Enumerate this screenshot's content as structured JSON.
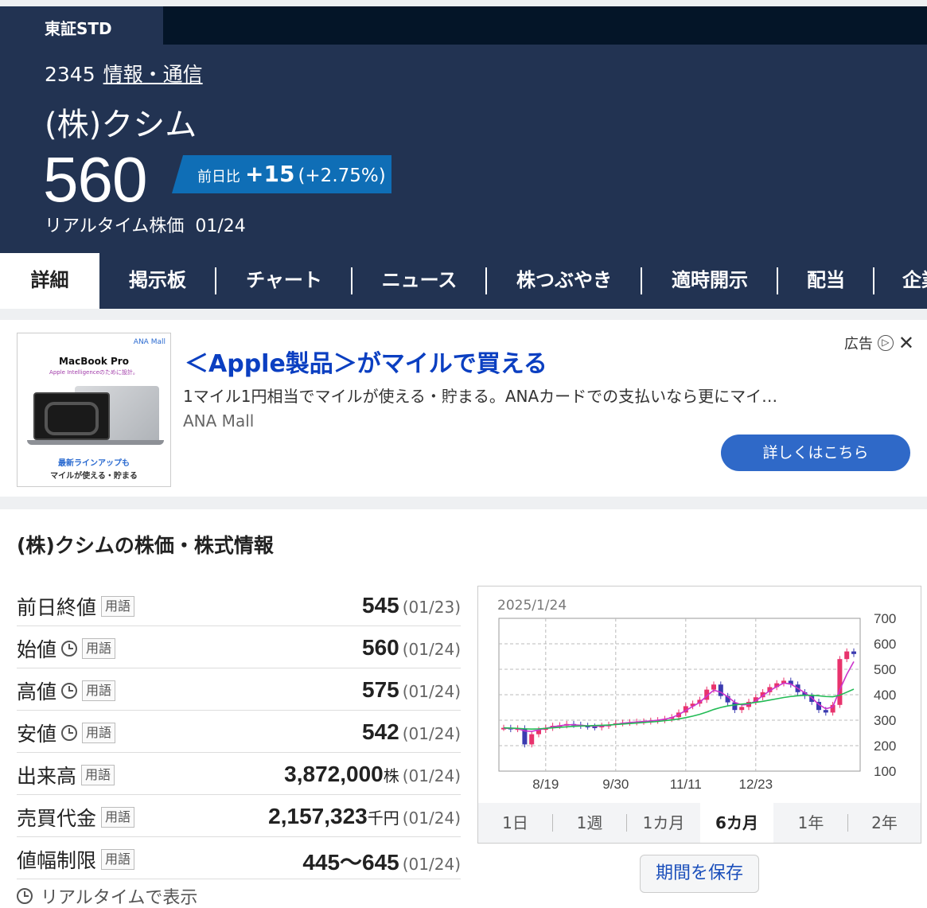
{
  "header": {
    "market": "東証STD",
    "code": "2345",
    "industry": "情報・通信",
    "company": "(株)クシム",
    "price": "560",
    "change_label": "前日比",
    "change_value": "+15",
    "change_pct": "(+2.75%)",
    "realtime_label": "リアルタイム株価",
    "realtime_date": "01/24"
  },
  "tabs": [
    "詳細",
    "掲示板",
    "チャート",
    "ニュース",
    "株つぶやき",
    "適時開示",
    "配当",
    "企業"
  ],
  "ad": {
    "image": {
      "brand": "ANA Mall",
      "product": "MacBook Pro",
      "tagline": "Apple Intelligenceのために設計。",
      "caption1": "最新ラインアップも",
      "caption2": "マイルが使える・貯まる"
    },
    "title": "＜Apple製品＞がマイルで買える",
    "description": "1マイル1円相当でマイルが使える・貯まる。ANAカードでの支払いなら更にマイ…",
    "sponsor": "ANA Mall",
    "label": "広告",
    "cta": "詳しくはこちら"
  },
  "info": {
    "title": "(株)クシムの株価・株式情報",
    "term_label": "用語",
    "rows": [
      {
        "label": "前日終値",
        "value": "545",
        "unit": "",
        "date": "(01/23)",
        "clock": false
      },
      {
        "label": "始値",
        "value": "560",
        "unit": "",
        "date": "(01/24)",
        "clock": true
      },
      {
        "label": "高値",
        "value": "575",
        "unit": "",
        "date": "(01/24)",
        "clock": true
      },
      {
        "label": "安値",
        "value": "542",
        "unit": "",
        "date": "(01/24)",
        "clock": true
      },
      {
        "label": "出来高",
        "value": "3,872,000",
        "unit": "株",
        "date": "(01/24)",
        "clock": false
      },
      {
        "label": "売買代金",
        "value": "2,157,323",
        "unit": "千円",
        "date": "(01/24)",
        "clock": false
      },
      {
        "label": "値幅制限",
        "value": "445～645",
        "unit": "",
        "date": "(01/24)",
        "clock": false
      }
    ],
    "realtime_link": "リアルタイムで表示"
  },
  "chart": {
    "date": "2025/1/24",
    "periods": [
      "1日",
      "1週",
      "1カ月",
      "6カ月",
      "1年",
      "2年"
    ],
    "active_period": "6カ月",
    "save_label": "期間を保存"
  },
  "chart_data": {
    "type": "line",
    "x_ticks": [
      "8/19",
      "9/30",
      "11/11",
      "12/23"
    ],
    "y_ticks": [
      700,
      600,
      500,
      400,
      300,
      200,
      100
    ],
    "ylim": [
      100,
      700
    ],
    "series": [
      {
        "values": [
          270,
          265,
          268,
          205,
          245,
          262,
          270,
          278,
          280,
          285,
          282,
          278,
          275,
          272,
          278,
          282,
          288,
          290,
          292,
          294,
          295,
          298,
          300,
          305,
          312,
          330,
          355,
          365,
          380,
          420,
          440,
          395,
          370,
          340,
          352,
          372,
          390,
          410,
          430,
          445,
          455,
          440,
          410,
          395,
          372,
          340,
          330,
          360,
          540,
          570,
          560
        ]
      },
      {
        "values": [
          268,
          268,
          267,
          258,
          256,
          262,
          268,
          274,
          278,
          282,
          282,
          280,
          278,
          276,
          277,
          280,
          284,
          288,
          291,
          293,
          295,
          297,
          300,
          304,
          310,
          322,
          338,
          354,
          370,
          395,
          418,
          410,
          392,
          370,
          360,
          362,
          376,
          396,
          416,
          432,
          446,
          442,
          425,
          408,
          388,
          362,
          345,
          352,
          420,
          480,
          530
        ]
      },
      {
        "values": [
          270,
          269,
          268,
          266,
          265,
          266,
          268,
          270,
          272,
          274,
          276,
          277,
          278,
          279,
          280,
          281,
          283,
          285,
          287,
          289,
          291,
          293,
          295,
          298,
          301,
          305,
          310,
          316,
          323,
          332,
          342,
          350,
          356,
          360,
          363,
          366,
          370,
          374,
          379,
          384,
          389,
          393,
          396,
          398,
          398,
          396,
          393,
          392,
          398,
          410,
          422
        ]
      }
    ]
  }
}
